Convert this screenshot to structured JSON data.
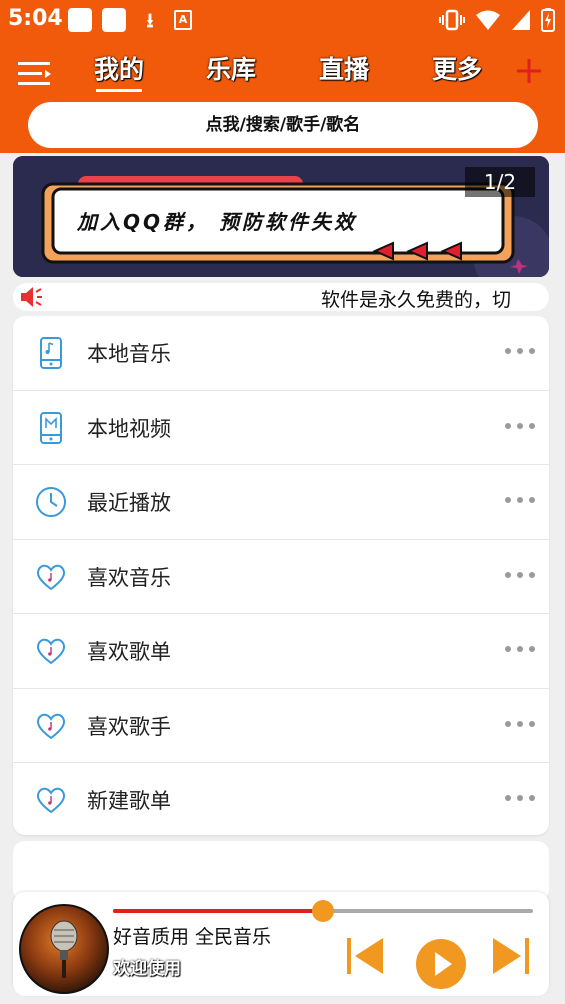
{
  "status_bar": {
    "time": "5:04"
  },
  "nav": {
    "tabs": [
      {
        "label": "我的",
        "active": true
      },
      {
        "label": "乐库",
        "active": false
      },
      {
        "label": "直播",
        "active": false
      },
      {
        "label": "更多",
        "active": false
      }
    ]
  },
  "search": {
    "placeholder": "点我/搜索/歌手/歌名"
  },
  "banner": {
    "counter": "1/2",
    "text": "加入QQ群， 预防软件失效"
  },
  "marquee": {
    "text": "软件是永久免费的，切"
  },
  "menu_items": [
    {
      "label": "本地音乐",
      "icon": "phone-music-icon"
    },
    {
      "label": "本地视频",
      "icon": "phone-video-icon"
    },
    {
      "label": "最近播放",
      "icon": "clock-icon"
    },
    {
      "label": "喜欢音乐",
      "icon": "heart-music-icon"
    },
    {
      "label": "喜欢歌单",
      "icon": "heart-music-icon"
    },
    {
      "label": "喜欢歌手",
      "icon": "heart-music-icon"
    },
    {
      "label": "新建歌单",
      "icon": "heart-music-icon"
    }
  ],
  "player": {
    "title": "好音质用 全民音乐",
    "subtitle": "欢迎使用",
    "progress": 0.5
  },
  "colors": {
    "header": "#f15a0a",
    "accent": "#f19820",
    "icon_blue": "#3a9ad9",
    "progress": "#e02020"
  }
}
